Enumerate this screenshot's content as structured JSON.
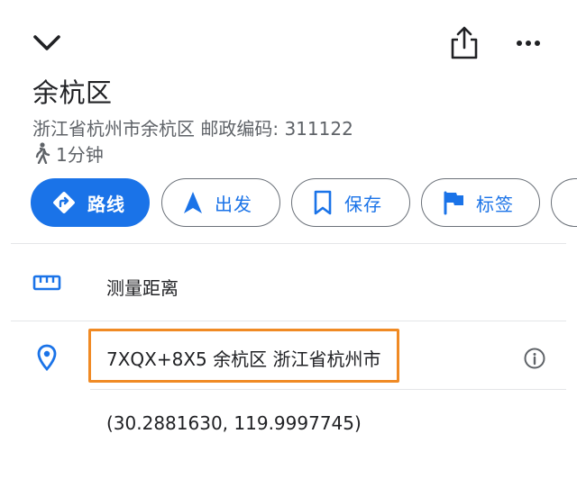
{
  "place": {
    "title": "余杭区",
    "subtitle": "浙江省杭州市余杭区 邮政编码: 311122",
    "walk_time": "1分钟"
  },
  "actions": [
    {
      "label": "路线",
      "icon": "directions-icon"
    },
    {
      "label": "出发",
      "icon": "navigation-arrow-icon"
    },
    {
      "label": "保存",
      "icon": "bookmark-icon"
    },
    {
      "label": "标签",
      "icon": "flag-icon"
    }
  ],
  "details": {
    "measure_label": "测量距离",
    "plus_code": "7XQX+8X5 余杭区 浙江省杭州市",
    "coordinates": "(30.2881630, 119.9997745)"
  },
  "colors": {
    "accent": "#1a73e8",
    "highlight_box": "#f08a24",
    "secondary_text": "#5f6368"
  }
}
